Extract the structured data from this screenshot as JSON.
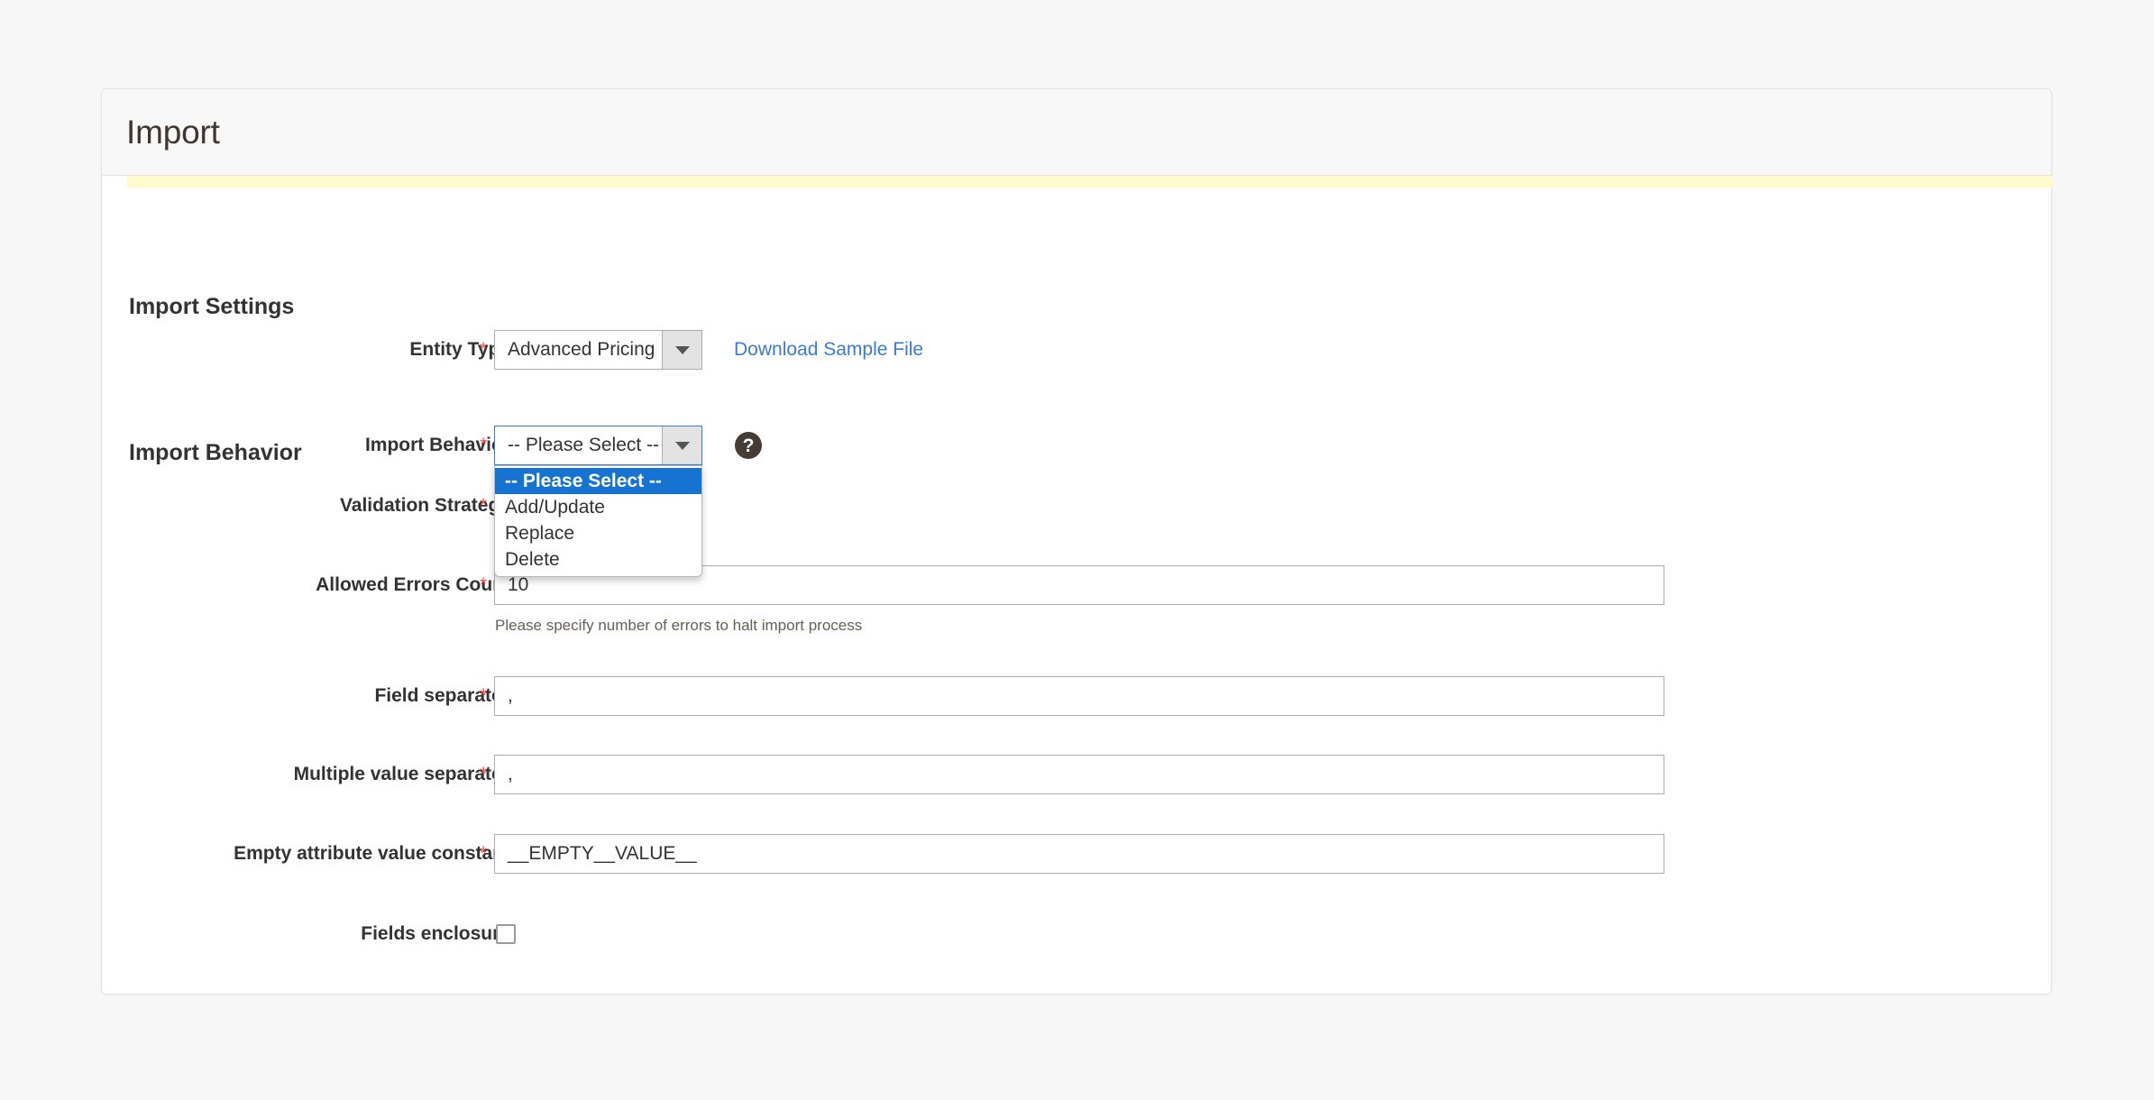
{
  "page": {
    "title": "Import"
  },
  "sections": {
    "import_settings": "Import Settings",
    "import_behavior": "Import Behavior"
  },
  "fields": {
    "entity_type": {
      "label": "Entity Type",
      "required_marker": "*",
      "value": "Advanced Pricing",
      "link_label": "Download Sample File"
    },
    "import_behavior": {
      "label": "Import Behavior",
      "required_marker": "*",
      "value": "-- Please Select --",
      "help_glyph": "?",
      "options": [
        "-- Please Select --",
        "Add/Update",
        "Replace",
        "Delete"
      ],
      "selected_option_index": 0
    },
    "validation_strategy": {
      "label": "Validation Strategy",
      "required_marker": "*",
      "value": ""
    },
    "allowed_errors_count": {
      "label": "Allowed Errors Count",
      "required_marker": "*",
      "value": "10",
      "note": "Please specify number of errors to halt import process"
    },
    "field_separator": {
      "label": "Field separator",
      "required_marker": "*",
      "value": ","
    },
    "multiple_value_separator": {
      "label": "Multiple value separator",
      "required_marker": "*",
      "value": ","
    },
    "empty_attribute_value_constant": {
      "label": "Empty attribute value constant",
      "required_marker": "*",
      "value": "__EMPTY__VALUE__"
    },
    "fields_enclosure": {
      "label": "Fields enclosure",
      "checked": false
    }
  },
  "colors": {
    "accent_bar": "#fffbcc",
    "link": "#3a7bd5",
    "required": "#e8574c",
    "dropdown_highlight": "#1673d2",
    "focus_border": "#3a7bd5"
  }
}
